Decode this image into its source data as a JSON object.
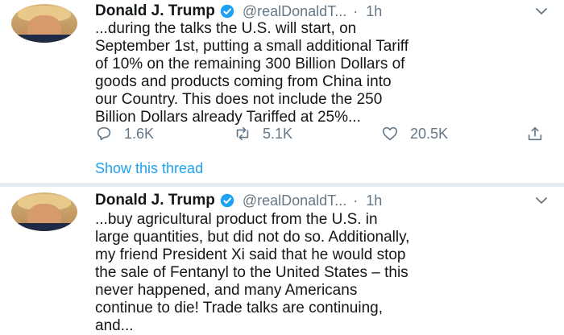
{
  "tweets": [
    {
      "display_name": "Donald J. Trump",
      "handle": "@realDonaldT...",
      "separator": "·",
      "time": "1h",
      "verified_icon": "verified-badge-icon",
      "text": "...during the talks the U.S. will start, on\nSeptember 1st, putting a small additional Tariff\nof 10% on the remaining 300 Billion Dollars of\ngoods and products coming from China into\nour Country. This does not include the 250\nBillion Dollars already Tariffed at 25%...",
      "actions": {
        "reply_count": "1.6K",
        "retweet_count": "5.1K",
        "like_count": "20.5K"
      },
      "show_thread": "Show this thread"
    },
    {
      "display_name": "Donald J. Trump",
      "handle": "@realDonaldT...",
      "separator": "·",
      "time": "1h",
      "verified_icon": "verified-badge-icon",
      "text": "...buy agricultural product from the U.S. in\nlarge quantities, but did not do so. Additionally,\nmy friend President Xi said that he would stop\nthe sale of Fentanyl to the United States – this\nnever happened, and many Americans\ncontinue to die! Trade talks are continuing,\nand..."
    }
  ],
  "colors": {
    "link_blue": "#1da1f2",
    "verified_blue": "#1da1f2",
    "muted_gray": "#657786",
    "divider": "#e6ecf0"
  }
}
